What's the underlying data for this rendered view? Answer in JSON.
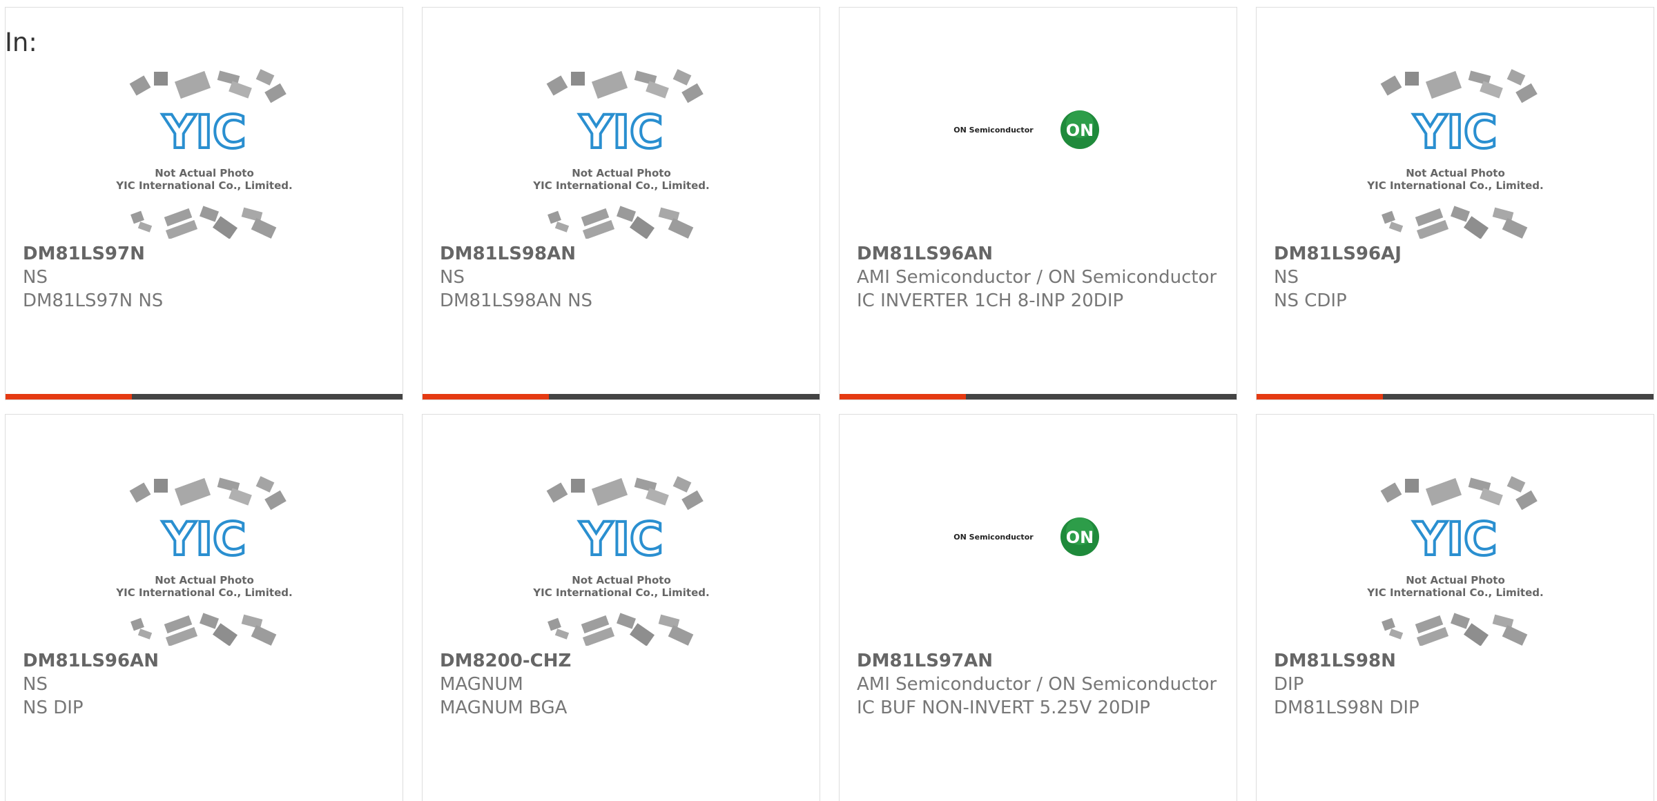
{
  "header": {
    "label": "In:"
  },
  "colors": {
    "accent": "#e53a12",
    "bar": "#444444",
    "yic_blue": "#2a8fd0",
    "on_green": "#1f8a3b"
  },
  "placeholder": {
    "line1": "Not Actual Photo",
    "line2": "YIC International Co., Limited.",
    "logo_text": "YIC"
  },
  "on_logo": {
    "text": "ON Semiconductor",
    "badge": "ON"
  },
  "products": [
    {
      "part": "DM81LS97N",
      "maker": "NS",
      "desc": "DM81LS97N NS",
      "image": "yic-placeholder"
    },
    {
      "part": "DM81LS98AN",
      "maker": "NS",
      "desc": "DM81LS98AN NS",
      "image": "yic-placeholder"
    },
    {
      "part": "DM81LS96AN",
      "maker": "AMI Semiconductor / ON Semiconductor",
      "desc": "IC INVERTER 1CH 8-INP 20DIP",
      "image": "on-semi-logo"
    },
    {
      "part": "DM81LS96AJ",
      "maker": "NS",
      "desc": "NS CDIP",
      "image": "yic-placeholder"
    },
    {
      "part": "DM81LS96AN",
      "maker": "NS",
      "desc": "NS DIP",
      "image": "yic-placeholder"
    },
    {
      "part": "DM8200-CHZ",
      "maker": "MAGNUM",
      "desc": "MAGNUM BGA",
      "image": "yic-placeholder"
    },
    {
      "part": "DM81LS97AN",
      "maker": "AMI Semiconductor / ON Semiconductor",
      "desc": "IC BUF NON-INVERT 5.25V 20DIP",
      "image": "on-semi-logo"
    },
    {
      "part": "DM81LS98N",
      "maker": "DIP",
      "desc": "DM81LS98N DIP",
      "image": "yic-placeholder"
    }
  ]
}
